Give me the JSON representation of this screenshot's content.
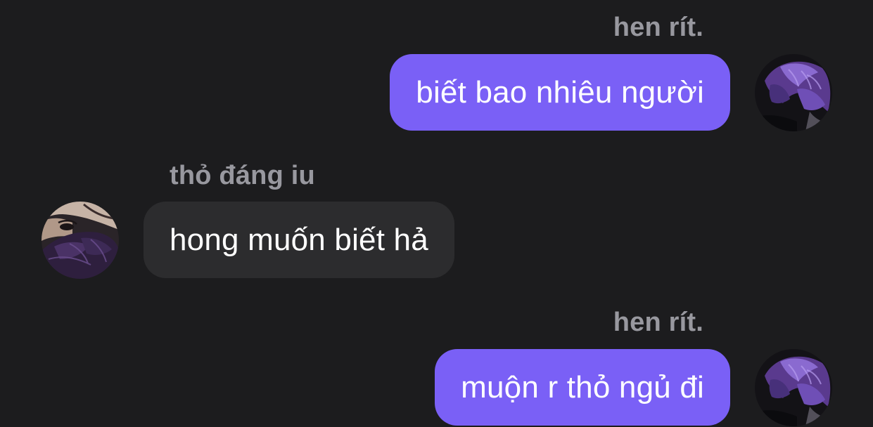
{
  "messages": [
    {
      "direction": "outgoing",
      "sender": "hen rít.",
      "text": "biết bao nhiêu người",
      "avatar": "purple-hair-avatar"
    },
    {
      "direction": "incoming",
      "sender": "thỏ đáng iu",
      "text": "hong muốn biết hả",
      "avatar": "face-peek-avatar"
    },
    {
      "direction": "outgoing",
      "sender": "hen rít.",
      "text": "muộn r thỏ ngủ đi",
      "avatar": "purple-hair-avatar"
    }
  ],
  "colors": {
    "background": "#1c1c1e",
    "outgoing_bubble": "#7a60f6",
    "incoming_bubble": "#2c2c2e",
    "sender_name": "#98989f",
    "message_text": "#ffffff"
  }
}
